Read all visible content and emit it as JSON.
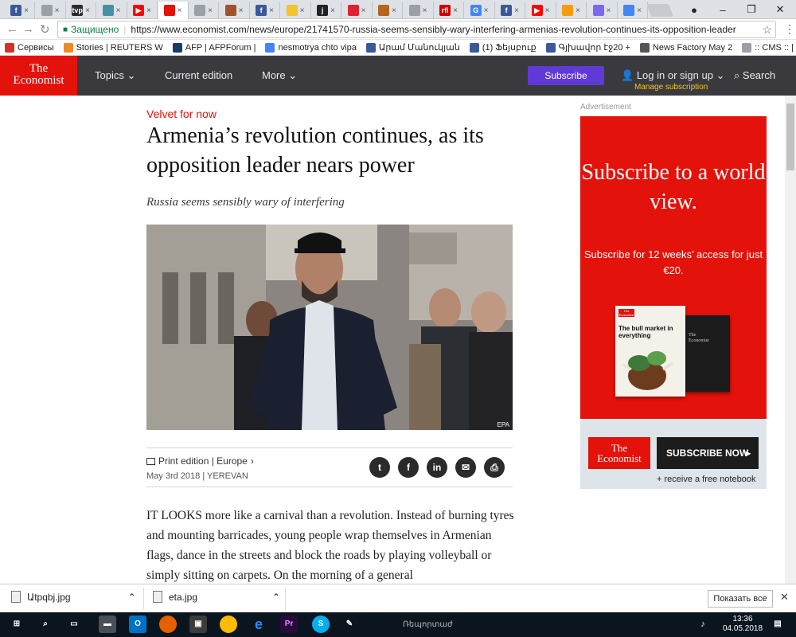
{
  "browser": {
    "tabs": [
      {
        "icon": "facebook-icon",
        "label": "f",
        "color": "#3b5998"
      },
      {
        "icon": "page-icon",
        "label": "",
        "color": "#9aa0a6"
      },
      {
        "icon": "tvp-icon",
        "label": "tvp",
        "color": "#2b2b2b"
      },
      {
        "icon": "site-icon",
        "label": "",
        "color": "#4a90a4"
      },
      {
        "icon": "youtube-icon",
        "label": "▶",
        "color": "#ff0000"
      },
      {
        "icon": "economist-icon",
        "label": "",
        "color": "#e3120b"
      },
      {
        "icon": "page-icon",
        "label": "",
        "color": "#9aa0a6"
      },
      {
        "icon": "bird-icon",
        "label": "",
        "color": "#a0522d"
      },
      {
        "icon": "facebook-icon",
        "label": "f",
        "color": "#3b5998"
      },
      {
        "icon": "coin-icon",
        "label": "",
        "color": "#f2c230"
      },
      {
        "icon": "j-icon",
        "label": "j",
        "color": "#222"
      },
      {
        "icon": "swirl-icon",
        "label": "",
        "color": "#d23"
      },
      {
        "icon": "news-icon",
        "label": "",
        "color": "#b5651d"
      },
      {
        "icon": "page-icon",
        "label": "",
        "color": "#9aa0a6"
      },
      {
        "icon": "rfi-icon",
        "label": "rfi",
        "color": "#c00"
      },
      {
        "icon": "google-icon",
        "label": "G",
        "color": "#4285f4"
      },
      {
        "icon": "facebook-icon",
        "label": "f",
        "color": "#3b5998"
      },
      {
        "icon": "youtube-icon",
        "label": "▶",
        "color": "#ff0000"
      },
      {
        "icon": "star-icon",
        "label": "",
        "color": "#f39c12"
      },
      {
        "icon": "mail-icon",
        "label": "",
        "color": "#7b68ee"
      },
      {
        "icon": "translate-icon",
        "label": "",
        "color": "#4285f4"
      }
    ],
    "close_glyph": "×",
    "secure_label": "Защищено",
    "url": "https://www.economist.com/news/europe/21741570-russia-seems-sensibly-wary-interfering-armenias-revolution-continues-its-opposition-leader",
    "bookmarks": [
      {
        "icon": "apps-icon",
        "label": "Сервисы",
        "color": "#d93025"
      },
      {
        "icon": "reuters-icon",
        "label": "Stories | REUTERS W",
        "color": "#f08a24"
      },
      {
        "icon": "afp-icon",
        "label": "AFP | AFPForum |",
        "color": "#1b3a6b"
      },
      {
        "icon": "google-icon",
        "label": "nesmotrya chto vipa",
        "color": "#4285f4"
      },
      {
        "icon": "facebook-icon",
        "label": "Արամ Մանուկյան",
        "color": "#3b5998"
      },
      {
        "icon": "facebook-icon",
        "label": "(1) Ֆեյսբուք",
        "color": "#3b5998"
      },
      {
        "icon": "facebook-icon",
        "label": "Գյխավոր էջ20 +",
        "color": "#3b5998"
      },
      {
        "icon": "news-icon",
        "label": "News Factory May 2",
        "color": "#555"
      },
      {
        "icon": "page-icon",
        "label": ":: CMS :: | 1.7.2",
        "color": "#9aa0a6"
      }
    ]
  },
  "economist_header": {
    "logo_line1": "The",
    "logo_line2": "Economist",
    "topics": "Topics",
    "current_edition": "Current edition",
    "more": "More",
    "subscribe": "Subscribe",
    "login": "Log in or sign up",
    "manage": "Manage subscription",
    "search": "Search"
  },
  "article": {
    "flytitle": "Velvet for now",
    "headline": "Armenia’s revolution continues, as its opposition leader nears power",
    "rubric": "Russia seems sensibly wary of interfering",
    "photo_credit": "EPA",
    "print_edition": "Print edition | Europe",
    "dateline": "May 3rd 2018 | YEREVAN",
    "share": [
      "twitter-icon",
      "facebook-icon",
      "linkedin-icon",
      "mail-icon",
      "print-icon"
    ],
    "body": "IT LOOKS more like a carnival than a revolution. Instead of burning tyres and mounting barricades, young people wrap themselves in Armenian flags, dance in the streets and block the roads by playing volleyball or simply sitting on carpets. On the morning of a general"
  },
  "ad": {
    "label": "Advertisement",
    "headline": "Subscribe to a world view.",
    "sub": "Subscribe for 12 weeks’ access for just €20.",
    "mag_title": "The bull market in everything",
    "logo_line1": "The",
    "logo_line2": "Economist",
    "button": "SUBSCRIBE NOW",
    "note": "+ receive a free notebook"
  },
  "downloads": {
    "items": [
      "Աtpqbj.jpg",
      "eta.jpg"
    ],
    "show_all": "Показать все"
  },
  "taskbar": {
    "label": "Ռեպորտաժ",
    "time": "13:36",
    "date": "04.05.2018"
  }
}
